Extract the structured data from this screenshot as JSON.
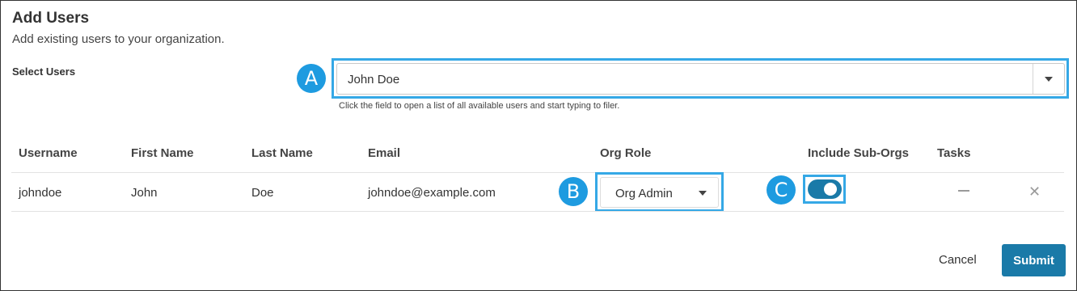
{
  "header": {
    "title": "Add Users",
    "subtitle": "Add existing users to your organization."
  },
  "select_users": {
    "label": "Select Users",
    "value": "John Doe",
    "helper": "Click the field to open a list of all available users and start typing to filer."
  },
  "callouts": [
    "A",
    "B",
    "C"
  ],
  "table": {
    "headers": [
      "Username",
      "First Name",
      "Last Name",
      "Email",
      "Org Role",
      "Include Sub-Orgs",
      "Tasks"
    ],
    "rows": [
      {
        "username": "johndoe",
        "first_name": "John",
        "last_name": "Doe",
        "email": "johndoe@example.com",
        "org_role": "Org Admin",
        "include_sub_orgs": true,
        "remove_icon": "✕"
      }
    ]
  },
  "actions": {
    "cancel": "Cancel",
    "submit": "Submit"
  },
  "colors": {
    "callout": "#1e9be0",
    "highlight": "#35a8e6",
    "primary": "#1a7aa8"
  }
}
